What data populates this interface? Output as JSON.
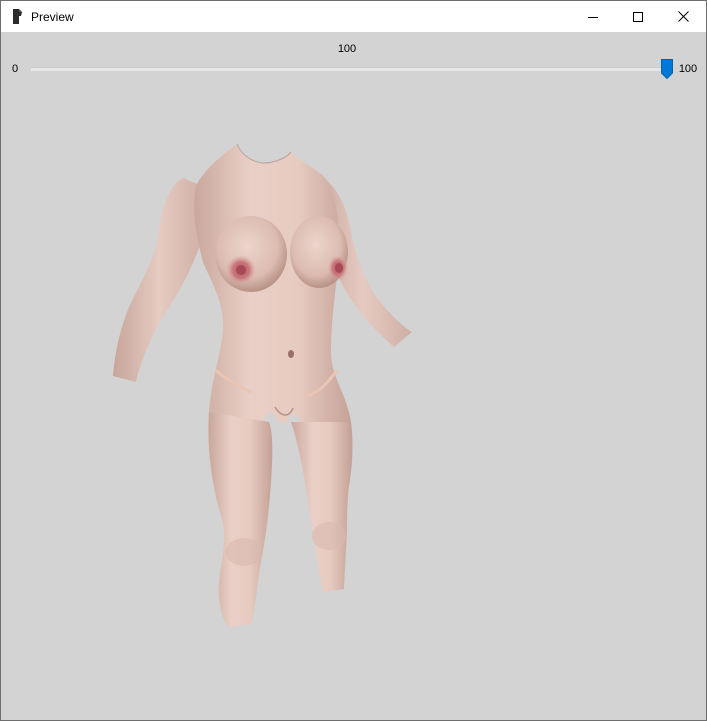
{
  "window": {
    "title": "Preview"
  },
  "titlebar": {
    "icons": [
      "app-icon",
      "minimize-icon",
      "maximize-icon",
      "close-icon"
    ]
  },
  "slider": {
    "value": "100",
    "min_label": "0",
    "max_label": "100",
    "level": 1.0,
    "thumb_color": "#0078d7",
    "track_color": "#e6e6e6"
  },
  "viewport": {
    "background": "#d3d3d3",
    "content": "3d-body-mesh-render"
  }
}
